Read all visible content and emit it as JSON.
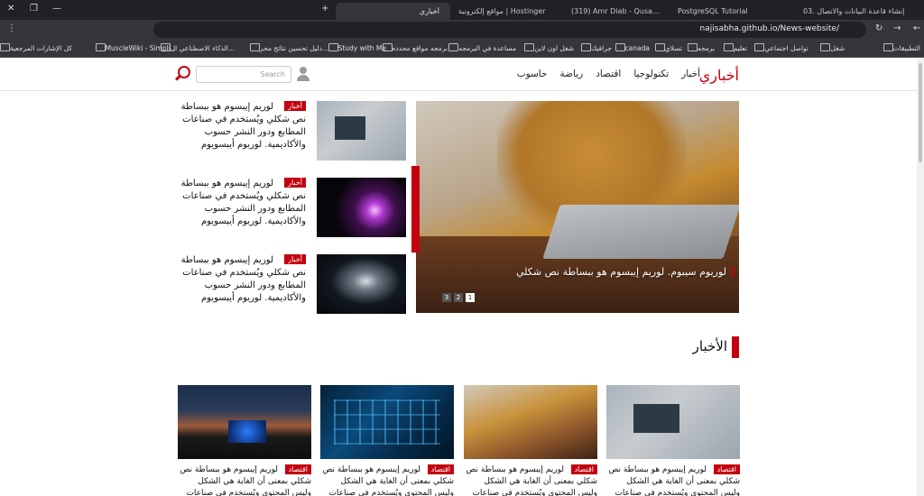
{
  "browser": {
    "tabs": [
      {
        "title": "03. إنشاء قاعدة البيانات والاتصال"
      },
      {
        "title": "PostgreSQL Tutorial"
      },
      {
        "title": "(319) Amr Diab - Qusad Einy |"
      },
      {
        "title": "مواقع إلكترونية | Hostinger"
      },
      {
        "title": "أخباري"
      }
    ],
    "url": "najisabha.github.io/News-website/",
    "bookmarks": [
      "التطبيقات",
      "شغل",
      "تواصل اجتماعي",
      "تعليم",
      "برمجه",
      "تسلاي",
      "canada",
      "جرافيك",
      "شغل اون لاين",
      "مساعدة في البرمجه",
      "برمجه مواقع محدده",
      "Study with Me",
      "دليل تحسين نتائج محر...",
      "الذكاء الاصطناعي ال...",
      "MuscleWiki - Simpli...",
      "كل الإشارات المرجعية"
    ]
  },
  "site": {
    "logo": "أخباري",
    "nav": [
      "أخبار",
      "تكنولوجيا",
      "اقتصاد",
      "رياضة",
      "حاسوب"
    ],
    "search_placeholder": "Search",
    "accent": "#c4000f"
  },
  "hero": {
    "caption": "لوريوم سيبوم. لوريم إيبسوم هو ببساطة نص شكلي",
    "pages": [
      "1",
      "2",
      "3"
    ]
  },
  "side_news": [
    {
      "badge": "أخبار",
      "text": "لوريم إيبسوم هو ببساطة نص شكلي ويُستخدم في صناعات المطابع ودور النشر حسوب والأكاديمية. لوريوم أيبسويوم"
    },
    {
      "badge": "أخبار",
      "text": "لوريم إيبسوم هو ببساطة نص شكلي ويُستخدم في صناعات المطابع ودور النشر حسوب والأكاديمية. لوريوم أيبسويوم"
    },
    {
      "badge": "أخبار",
      "text": "لوريم إيبسوم هو ببساطة نص شكلي ويُستخدم في صناعات المطابع ودور النشر حسوب والأكاديمية. لوريوم أيبسويوم"
    }
  ],
  "section_title": "الأخبار",
  "cards": [
    {
      "badge": "اقتصاد",
      "text": "لوريم إيبسوم هو ببساطة نص شكلي بمعنى أن الغاية هي الشكل وليس المحتوى ويُستخدم في صناعات المطابع"
    },
    {
      "badge": "اقتصاد",
      "text": "لوريم إيبسوم هو ببساطة نص شكلي بمعنى أن الغاية هي الشكل وليس المحتوى ويُستخدم في صناعات المطابع"
    },
    {
      "badge": "اقتصاد",
      "text": "لوريم إيبسوم هو ببساطة نص شكلي بمعنى أن الغاية هي الشكل وليس المحتوى ويُستخدم في صناعات المطابع"
    },
    {
      "badge": "اقتصاد",
      "text": "لوريم إيبسوم هو ببساطة نص شكلي بمعنى أن الغاية هي الشكل وليس المحتوى ويُستخدم في صناعات المطابع"
    }
  ]
}
